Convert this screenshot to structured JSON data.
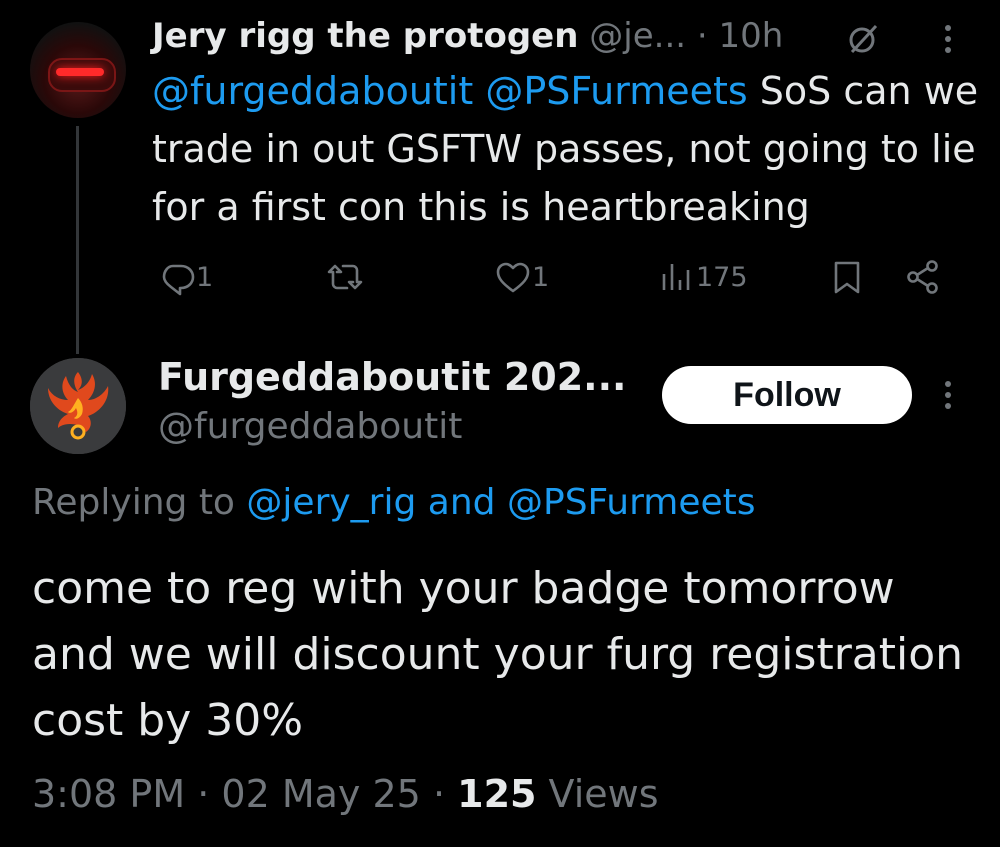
{
  "tweet1": {
    "name": "Jery rigg the protogen",
    "handle": "@je...",
    "separator": "·",
    "time": "10h",
    "mention1": "@furgeddaboutit",
    "mention2": "@PSFurmeets",
    "text": "SoS can we trade in out GSFTW passes, not going to lie for a first con this is heartbreaking",
    "actions": {
      "replies": "1",
      "reposts": "",
      "likes": "1",
      "views": "175"
    },
    "icons": [
      "reply-icon",
      "retweet-icon",
      "heart-icon",
      "views-icon",
      "bookmark-icon",
      "share-icon",
      "grok-icon",
      "more-icon"
    ]
  },
  "tweet2": {
    "name": "Furgeddaboutit 202...",
    "handle": "@furgeddaboutit",
    "follow_label": "Follow",
    "replying_prefix": "Replying to",
    "replying_user1": "@jery_rig",
    "replying_and": "and",
    "replying_user2": "@PSFurmeets",
    "text": "come to reg with your badge tomorrow and we will discount your furg registration cost by 30%",
    "time": "3:08 PM",
    "date": "02 May 25",
    "separator": "·",
    "views_count": "125",
    "views_label": "Views"
  },
  "colors": {
    "background": "#000000",
    "text": "#e7e9ea",
    "secondary": "#71767b",
    "link": "#1d9bf0",
    "follow_bg": "#ffffff"
  }
}
